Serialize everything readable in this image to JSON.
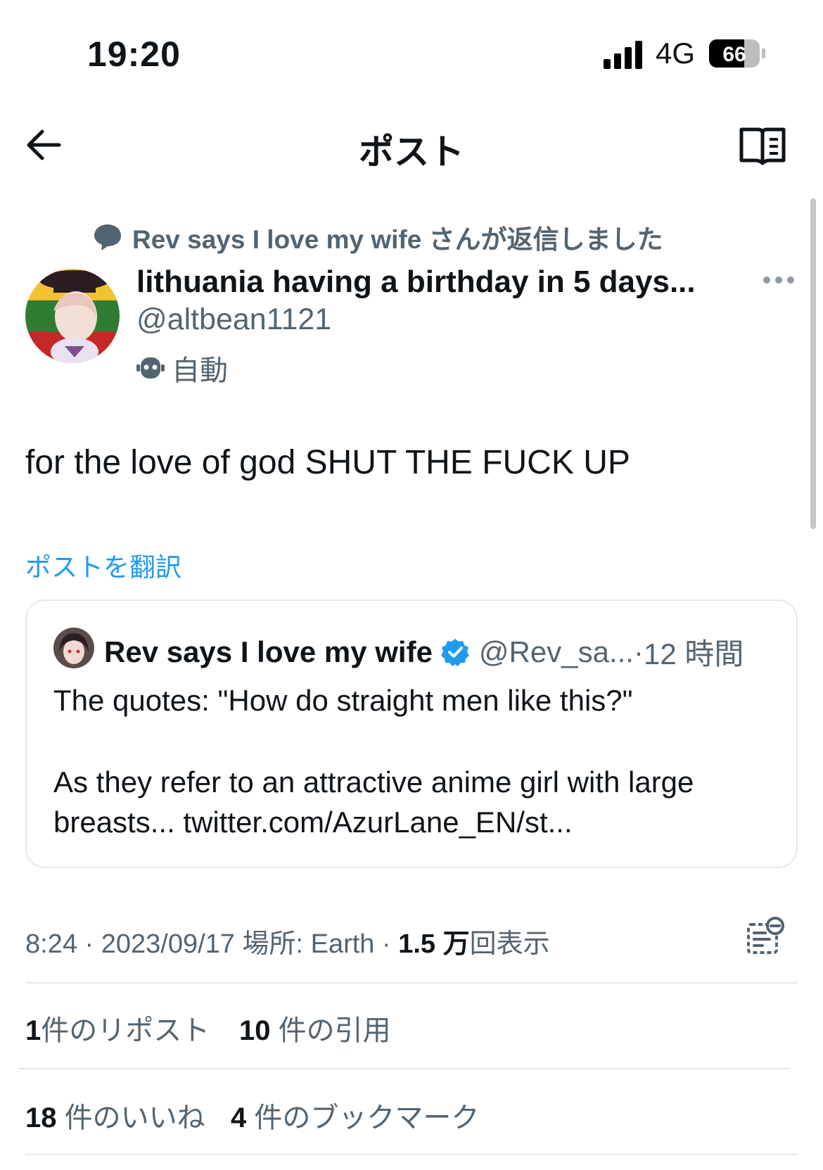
{
  "status_bar": {
    "time": "19:20",
    "network": "4G",
    "battery": "66"
  },
  "nav": {
    "title": "ポスト",
    "back_icon": "arrow-left-icon",
    "reader_icon": "book-icon"
  },
  "reply_context": {
    "text": "Rev says I love my wife さんが返信しました"
  },
  "post": {
    "author_name": "lithuania having a birthday in 5 days...",
    "author_handle": "@altbean1121",
    "automated_label": "自動",
    "body": "for the love of god SHUT THE FUCK UP",
    "translate_link": "ポストを翻訳"
  },
  "quoted_post": {
    "author_name": "Rev says I love my wife",
    "author_handle": "@Rev_sa...",
    "separator": " · ",
    "time_ago": "12 時間",
    "verified_color": "#1d9bf0",
    "line1": "The quotes: \"How do straight men like this?\"",
    "line2": "As they refer to an attractive anime girl with large",
    "line3": "breasts... twitter.com/AzurLane_EN/st..."
  },
  "meta": {
    "time_date": "8:24 · 2023/09/17 ",
    "location": "場所: Earth · ",
    "views_count": "1.5 万",
    "views_label": "回表示"
  },
  "stats": {
    "reposts_count": "1",
    "reposts_label": "件のリポスト",
    "quotes_count": "10",
    "quotes_label": " 件の引用",
    "likes_count": "18",
    "likes_label": " 件のいいね",
    "bookmarks_count": "4",
    "bookmarks_label": " 件のブックマーク"
  },
  "colors": {
    "link": "#1d9bf0",
    "secondary_text": "#536471",
    "primary_text": "#0f1419"
  }
}
